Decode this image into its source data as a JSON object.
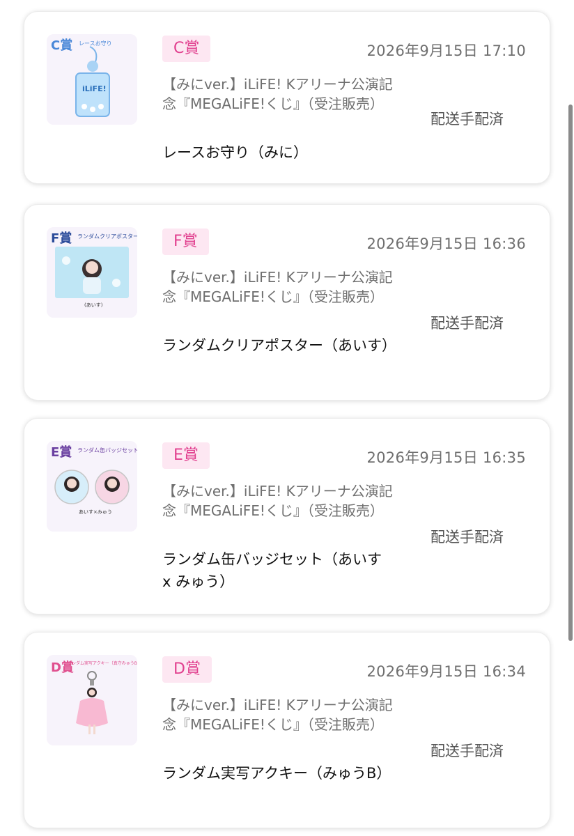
{
  "orders": [
    {
      "prize": "C賞",
      "datetime": "2026年9月15日 17:10",
      "event": "【みにver.】iLiFE! Kアリーナ公演記念『MEGALiFE!くじ』（受注販売）",
      "item": "レースお守り（みに）",
      "status": "配送手配済",
      "thumbnail": {
        "title": "レースお守り",
        "grade": "C賞",
        "image_text": "iLiFE!",
        "icon": "lace-charm-image",
        "grade_color": "#4a88d8"
      }
    },
    {
      "prize": "F賞",
      "datetime": "2026年9月15日 16:36",
      "event": "【みにver.】iLiFE! Kアリーナ公演記念『MEGALiFE!くじ』（受注販売）",
      "item": "ランダムクリアポスター（あいす）",
      "status": "配送手配済",
      "thumbnail": {
        "title": "ランダムクリアポスター",
        "grade": "F賞",
        "caption": "(あいす)",
        "icon": "clear-poster-image",
        "grade_color": "#2b4b9a"
      }
    },
    {
      "prize": "E賞",
      "datetime": "2026年9月15日 16:35",
      "event": "【みにver.】iLiFE! Kアリーナ公演記念『MEGALiFE!くじ』（受注販売）",
      "item": "ランダム缶バッジセット（あいす x みゅう）",
      "status": "配送手配済",
      "thumbnail": {
        "title": "ランダム缶バッジセット",
        "grade": "E賞",
        "caption": "あいす×みゅう",
        "icon": "can-badge-set-image",
        "grade_color": "#6a3fa0"
      }
    },
    {
      "prize": "D賞",
      "datetime": "2026年9月15日 16:34",
      "event": "【みにver.】iLiFE! Kアリーナ公演記念『MEGALiFE!くじ』（受注販売）",
      "item": "ランダム実写アクキー（みゅうB）",
      "status": "配送手配済",
      "thumbnail": {
        "title": "ランダム実写アクキー（真守みゅうB）",
        "grade": "D賞",
        "icon": "acrylic-keychain-image",
        "grade_color": "#e0508f"
      }
    }
  ],
  "colors": {
    "badge_bg": "#fde7f2",
    "badge_text": "#e1408f",
    "muted_text": "#6f6f6f"
  }
}
